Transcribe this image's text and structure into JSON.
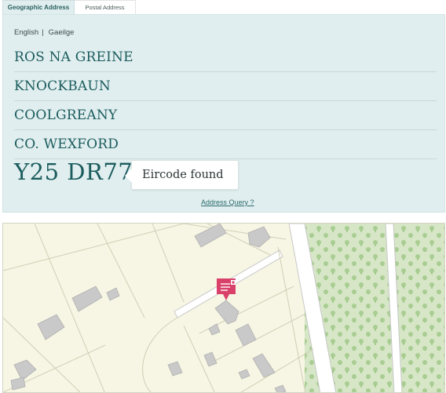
{
  "tabs": [
    {
      "label": "Geographic Address",
      "active": true
    },
    {
      "label": "Postal Address",
      "active": false
    }
  ],
  "language": {
    "english": "English",
    "separator": "|",
    "irish": "Gaeilge"
  },
  "address_lines": [
    "ROS NA GREINE",
    "KNOCKBAUN",
    "COOLGREANY",
    "CO. WEXFORD"
  ],
  "eircode": "Y25 DR77",
  "status_message": "Eircode found",
  "address_query_link": "Address Query ?",
  "colors": {
    "panel_bg": "#e1eeef",
    "text_teal": "#1b5c5d",
    "map_bg": "#f7f6e4",
    "forest": "#d6e6c6",
    "marker": "#d9416b"
  },
  "map": {
    "marker_icon": "map-pin-icon"
  }
}
